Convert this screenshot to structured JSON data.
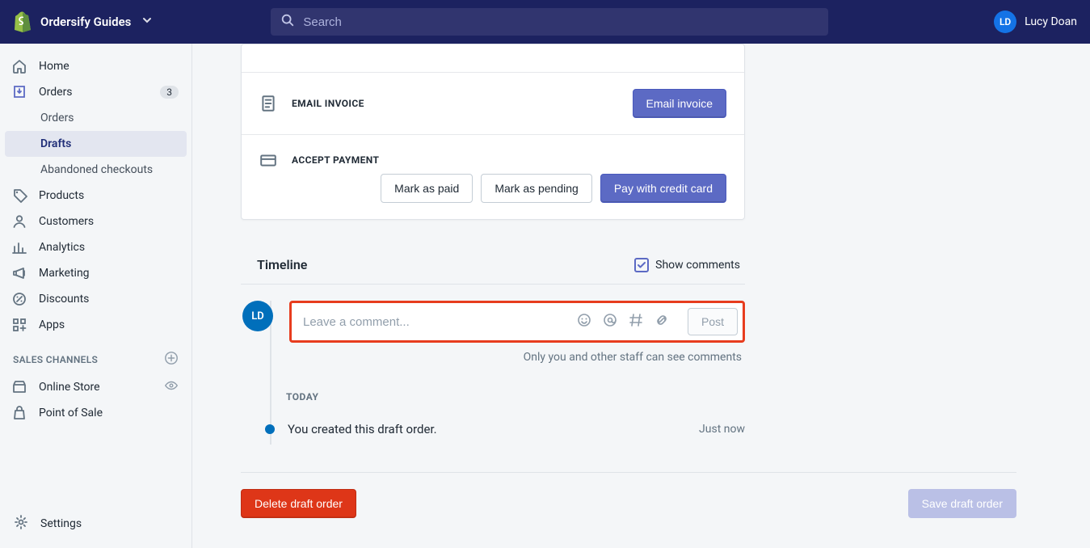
{
  "header": {
    "store_name": "Ordersify Guides",
    "search_placeholder": "Search",
    "user_initials": "LD",
    "user_name": "Lucy Doan"
  },
  "sidebar": {
    "items": [
      {
        "label": "Home"
      },
      {
        "label": "Orders",
        "badge": "3"
      },
      {
        "label": "Orders"
      },
      {
        "label": "Drafts"
      },
      {
        "label": "Abandoned checkouts"
      },
      {
        "label": "Products"
      },
      {
        "label": "Customers"
      },
      {
        "label": "Analytics"
      },
      {
        "label": "Marketing"
      },
      {
        "label": "Discounts"
      },
      {
        "label": "Apps"
      }
    ],
    "sales_channels_label": "SALES CHANNELS",
    "channels": [
      {
        "label": "Online Store"
      },
      {
        "label": "Point of Sale"
      }
    ],
    "settings_label": "Settings"
  },
  "card": {
    "email_section": {
      "title": "EMAIL INVOICE",
      "button": "Email invoice"
    },
    "payment_section": {
      "title": "ACCEPT PAYMENT",
      "buttons": {
        "paid": "Mark as paid",
        "pending": "Mark as pending",
        "credit": "Pay with credit card"
      }
    }
  },
  "timeline": {
    "title": "Timeline",
    "show_comments_label": "Show comments",
    "comment_placeholder": "Leave a comment...",
    "post_label": "Post",
    "note": "Only you and other staff can see comments",
    "today_label": "TODAY",
    "entries": [
      {
        "text": "You created this draft order.",
        "time": "Just now"
      }
    ],
    "avatar_initials": "LD"
  },
  "footer": {
    "delete": "Delete draft order",
    "save": "Save draft order"
  }
}
